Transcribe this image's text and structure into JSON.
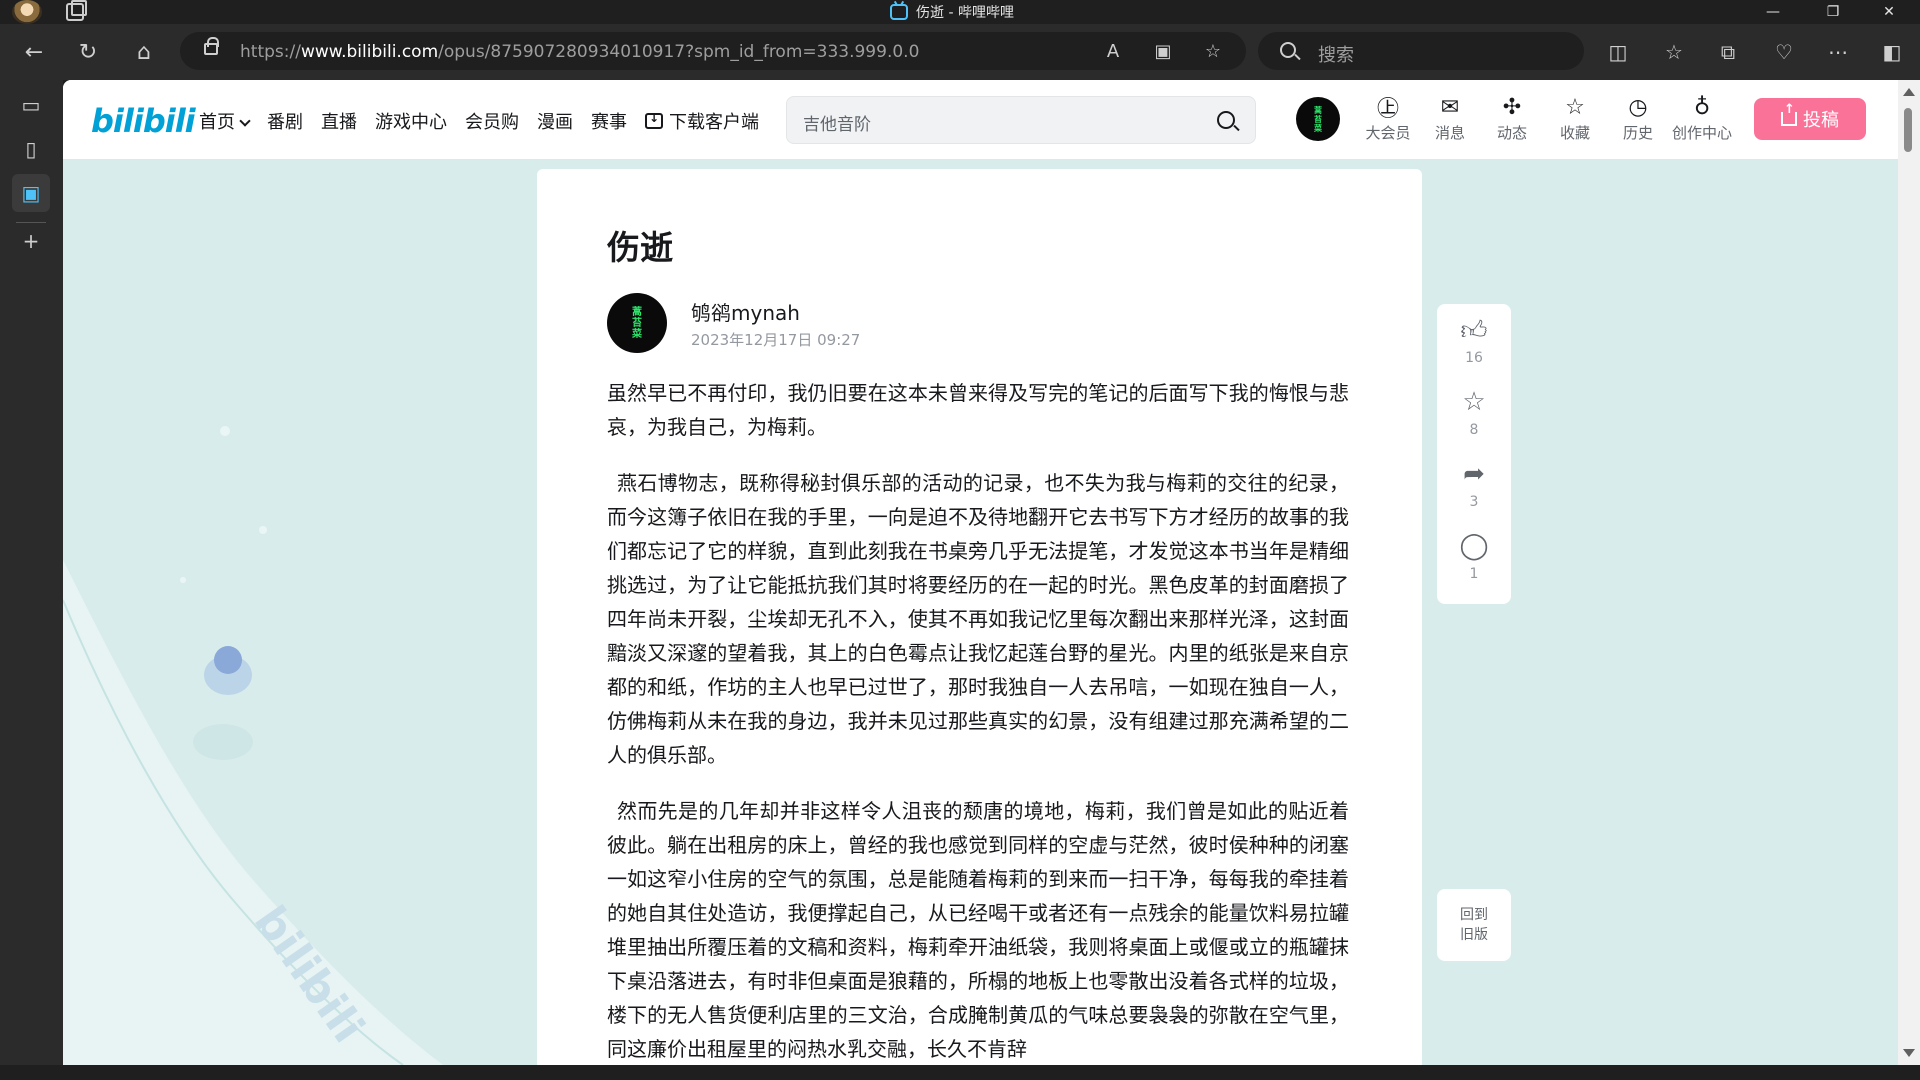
{
  "window": {
    "title": "伤逝 - 哔哩哔哩",
    "controls": [
      "—",
      "❐",
      "✕"
    ]
  },
  "browser": {
    "url_prefix": "https://",
    "url_host": "www.bilibili.com",
    "url_path": "/opus/875907280934010917?spm_id_from=333.999.0.0",
    "search_placeholder": "搜索"
  },
  "bili": {
    "logo": "bilibili",
    "nav": {
      "home": "首页",
      "bangumi": "番剧",
      "live": "直播",
      "game": "游戏中心",
      "vip_shop": "会员购",
      "manga": "漫画",
      "match": "赛事",
      "download": "下载客户端"
    },
    "search_placeholder": "吉他音阶",
    "header_icons": {
      "vip": "大会员",
      "message": "消息",
      "dynamic": "动态",
      "favorite": "收藏",
      "history": "历史",
      "creator": "创作中心"
    },
    "upload": "投稿",
    "avatar_text": "蒿\n苔\n菜"
  },
  "article": {
    "title": "伤逝",
    "author": "鸲鹆mynah",
    "date": "2023年12月17日 09:27",
    "paragraphs": [
      "虽然早已不再付印，我仍旧要在这本未曾来得及写完的笔记的后面写下我的悔恨与悲哀，为我自己，为梅莉。",
      "燕石博物志，既称得秘封俱乐部的活动的记录，也不失为我与梅莉的交往的纪录，而今这簿子依旧在我的手里，一向是迫不及待地翻开它去书写下方才经历的故事的我们都忘记了它的样貌，直到此刻我在书桌旁几乎无法提笔，才发觉这本书当年是精细挑选过，为了让它能抵抗我们其时将要经历的在一起的时光。黑色皮革的封面磨损了四年尚未开裂，尘埃却无孔不入，使其不再如我记忆里每次翻出来那样光泽，这封面黯淡又深邃的望着我，其上的白色霉点让我忆起莲台野的星光。内里的纸张是来自京都的和纸，作坊的主人也早已过世了，那时我独自一人去吊唁，一如现在独自一人，仿佛梅莉从未在我的身边，我并未见过那些真实的幻景，没有组建过那充满希望的二人的俱乐部。",
      "然而先是的几年却并非这样令人沮丧的颓唐的境地，梅莉，我们曾是如此的贴近着彼此。躺在出租房的床上，曾经的我也感觉到同样的空虚与茫然，彼时侯种种的闭塞一如这窄小住房的空气的氛围，总是能随着梅莉的到来而一扫干净，每每我的牵挂着的她自其住处造访，我便撑起自己，从已经喝干或者还有一点残余的能量饮料易拉罐堆里抽出所覆压着的文稿和资料，梅莉牵开油纸袋，我则将桌面上或偃或立的瓶罐抹下桌沿落进去，有时非但桌面是狼藉的，所榻的地板上也零散出没着各式样的垃圾，楼下的无人售货便利店里的三文治，合成腌制黄瓜的气味总要袅袅的弥散在空气里，同这廉价出租屋里的闷热水乳交融，长久不肯辞"
    ]
  },
  "side_actions": {
    "like_count": "16",
    "fav_count": "8",
    "share_count": "3",
    "comment_count": "1",
    "back_old": "回到\n旧版"
  }
}
